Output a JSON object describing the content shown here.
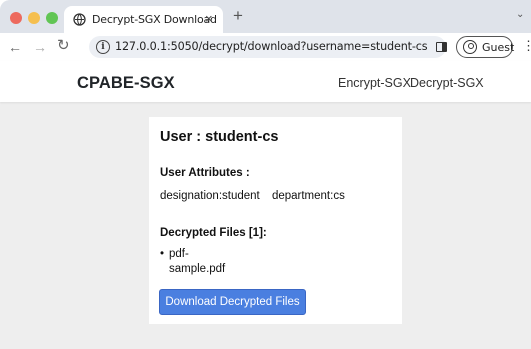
{
  "browser": {
    "tab_title": "Decrypt-SGX Download",
    "tab_close": "×",
    "new_tab": "+",
    "tab_menu": "⌄",
    "url": "127.0.0.1:5050/decrypt/download?username=student-cs",
    "profile_label": "Guest",
    "back": "←",
    "forward": "→",
    "reload": "↻",
    "kebab": "⋮",
    "info": "i"
  },
  "site": {
    "brand": "CPABE-SGX",
    "nav": [
      "Encrypt-SGX",
      "Decrypt-SGX"
    ]
  },
  "card": {
    "title": "User : student-cs",
    "attributes_heading": "User Attributes :",
    "attributes": [
      "designation:student",
      "department:cs"
    ],
    "files_heading": "Decrypted Files [1]:",
    "files": [
      "pdf-sample.pdf"
    ],
    "download_button": "Download Decrypted Files"
  },
  "colors": {
    "button": "#4a7fe0",
    "traffic_close": "#ed6a5e",
    "traffic_min": "#f5bf4f",
    "traffic_max": "#61c554"
  },
  "icons": [
    "info-icon",
    "sidepanel-icon",
    "profile-icon",
    "favicon-icon"
  ]
}
